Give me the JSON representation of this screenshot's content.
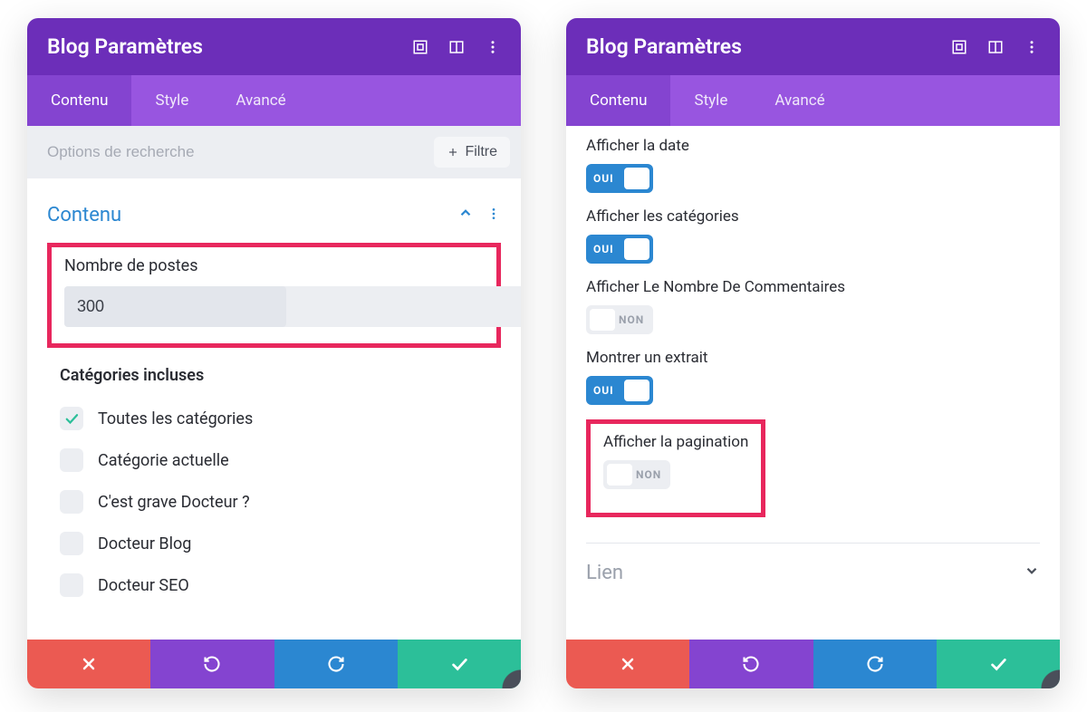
{
  "header": {
    "title": "Blog Paramètres"
  },
  "tabs": {
    "contenu": "Contenu",
    "style": "Style",
    "avance": "Avancé"
  },
  "search": {
    "placeholder": "Options de recherche",
    "filter_label": "Filtre"
  },
  "section": {
    "contenu_title": "Contenu",
    "lien_title": "Lien"
  },
  "left": {
    "post_count": {
      "label": "Nombre de postes",
      "value": "300"
    },
    "categories": {
      "label": "Catégories incluses",
      "items": [
        {
          "label": "Toutes les catégories",
          "checked": true
        },
        {
          "label": "Catégorie actuelle",
          "checked": false
        },
        {
          "label": "C'est grave Docteur ?",
          "checked": false
        },
        {
          "label": "Docteur Blog",
          "checked": false
        },
        {
          "label": "Docteur SEO",
          "checked": false
        }
      ]
    }
  },
  "right": {
    "toggles": [
      {
        "label": "Afficher la date",
        "on": true
      },
      {
        "label": "Afficher les catégories",
        "on": true
      },
      {
        "label": "Afficher Le Nombre De Commentaires",
        "on": false
      },
      {
        "label": "Montrer un extrait",
        "on": true
      },
      {
        "label": "Afficher la pagination",
        "on": false,
        "highlight": true
      }
    ]
  },
  "toggle_text": {
    "on": "OUI",
    "off": "NON"
  }
}
